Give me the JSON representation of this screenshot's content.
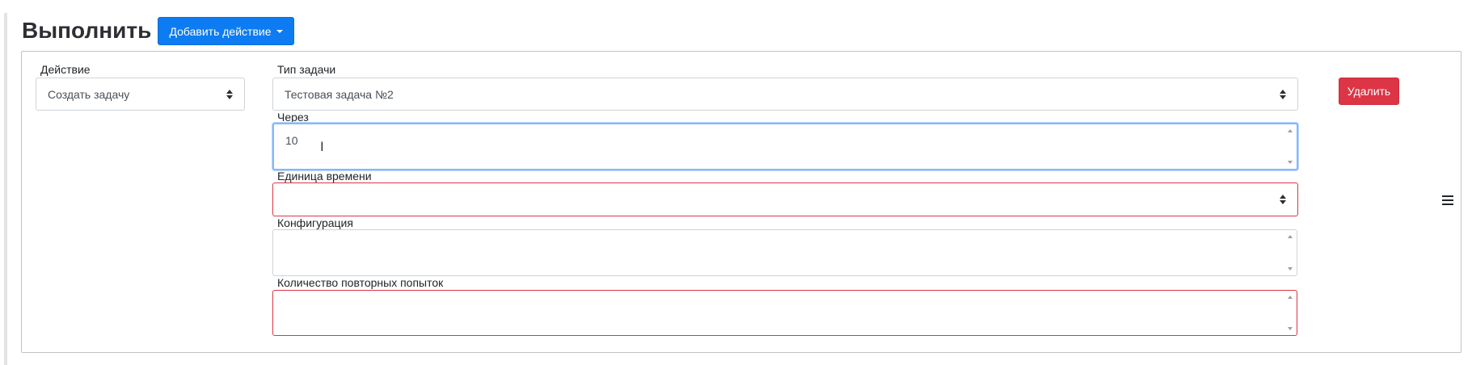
{
  "section": {
    "title": "Выполнить",
    "add_action_label": "Добавить действие"
  },
  "action": {
    "label": "Действие",
    "value": "Создать задачу"
  },
  "task_type": {
    "label": "Тип задачи",
    "value": "Тестовая задача №2"
  },
  "after": {
    "label": "Через",
    "value": "10"
  },
  "time_unit": {
    "label": "Единица времени",
    "value": ""
  },
  "config": {
    "label": "Конфигурация",
    "value": ""
  },
  "retries": {
    "label": "Количество повторных попыток",
    "value": ""
  },
  "delete_label": "Удалить",
  "colors": {
    "primary": "#0d7bf2",
    "danger": "#dc3545",
    "focus": "#86b7fe"
  },
  "icons": {
    "add_caret": "caret-down-icon",
    "select_arrows": "select-arrows-icon",
    "drag": "drag-handle-icon"
  }
}
